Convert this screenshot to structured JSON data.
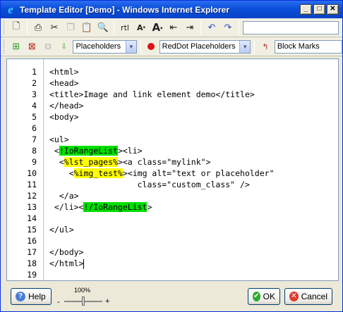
{
  "window": {
    "title": "Template Editor [Demo] - Windows Internet Explorer",
    "controls": {
      "minimize": "_",
      "maximize": "□",
      "close": "✕"
    }
  },
  "toolbar2": {
    "placeholders_select": "Placeholders",
    "reddot_select": "RedDot Placeholders",
    "blockmarks_select": "Block Marks"
  },
  "editor": {
    "lines": [
      {
        "n": "1",
        "segments": [
          {
            "t": "<html>"
          }
        ]
      },
      {
        "n": "2",
        "segments": [
          {
            "t": "<head>"
          }
        ]
      },
      {
        "n": "3",
        "segments": [
          {
            "t": "<title>Image and link element demo</title>"
          }
        ]
      },
      {
        "n": "4",
        "segments": [
          {
            "t": "</head>"
          }
        ]
      },
      {
        "n": "5",
        "segments": [
          {
            "t": "<body>"
          }
        ]
      },
      {
        "n": "6",
        "segments": []
      },
      {
        "n": "7",
        "segments": [
          {
            "t": "<ul>"
          }
        ]
      },
      {
        "n": "8",
        "segments": [
          {
            "t": " <"
          },
          {
            "t": "!IoRangeList",
            "hl": "green"
          },
          {
            "t": "><li>"
          }
        ]
      },
      {
        "n": "9",
        "segments": [
          {
            "t": "  <"
          },
          {
            "t": "%lst_pages%",
            "hl": "yellow"
          },
          {
            "t": "><a class=\"mylink\">"
          }
        ]
      },
      {
        "n": "10",
        "segments": [
          {
            "t": "    <"
          },
          {
            "t": "%img_test%",
            "hl": "yellow"
          },
          {
            "t": "><img alt=\"text or placeholder\""
          }
        ]
      },
      {
        "n": "11",
        "segments": [
          {
            "t": "                  class=\"custom_class\" />"
          }
        ]
      },
      {
        "n": "12",
        "segments": [
          {
            "t": "  </a>"
          }
        ]
      },
      {
        "n": "13",
        "segments": [
          {
            "t": " </li><"
          },
          {
            "t": "!/IoRangeList",
            "hl": "green"
          },
          {
            "t": ">"
          }
        ]
      },
      {
        "n": "14",
        "segments": []
      },
      {
        "n": "15",
        "segments": [
          {
            "t": "</ul>"
          }
        ]
      },
      {
        "n": "16",
        "segments": []
      },
      {
        "n": "17",
        "segments": [
          {
            "t": "</body>"
          }
        ]
      },
      {
        "n": "18",
        "segments": [
          {
            "t": "</html>"
          }
        ],
        "caret": true
      },
      {
        "n": "19",
        "segments": []
      }
    ]
  },
  "bottom": {
    "help_label": "Help",
    "zoom_value": "100%",
    "zoom_level": 0.5,
    "zoom_minus": "-",
    "zoom_plus": "+",
    "ok_label": "OK",
    "cancel_label": "Cancel"
  },
  "colors": {
    "highlight_green": "#00e000",
    "highlight_yellow": "#ffff00",
    "title_bar": "#0a4fd9"
  }
}
